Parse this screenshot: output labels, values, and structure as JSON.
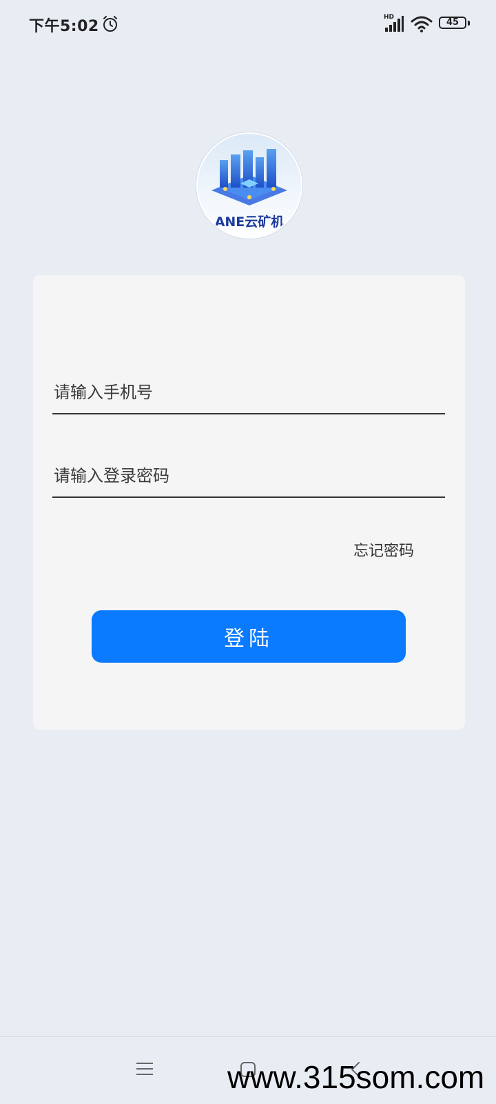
{
  "status_bar": {
    "time": "下午5:02",
    "network_label": "HD",
    "battery": "45",
    "icons": [
      "alarm-icon",
      "signal-icon",
      "wifi-icon",
      "battery-icon"
    ]
  },
  "logo": {
    "text": "ANE云矿机"
  },
  "login": {
    "phone_placeholder": "请输入手机号",
    "password_placeholder": "请输入登录密码",
    "forgot_label": "忘记密码",
    "login_label": "登陆"
  },
  "nav_bar": {
    "icons": [
      "menu-icon",
      "home-icon",
      "back-icon"
    ]
  },
  "watermark": "www.315som.com",
  "colors": {
    "background": "#e8ecf3",
    "card": "#f5f5f6",
    "accent": "#0a7afe"
  }
}
